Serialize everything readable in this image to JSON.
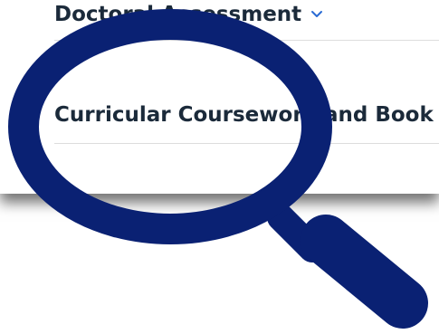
{
  "menu": {
    "items": [
      {
        "label": "Doctoral Assessment",
        "has_dropdown": true
      },
      {
        "label": "Curricular Coursework and Book"
      }
    ]
  },
  "colors": {
    "menu_text": "#1b2a3a",
    "chevron": "#2a6bd4",
    "magnifier": "#0a2173",
    "divider": "#dddddd"
  },
  "icons": {
    "dropdown": "chevron-down-icon",
    "overlay": "magnifying-glass-icon"
  }
}
